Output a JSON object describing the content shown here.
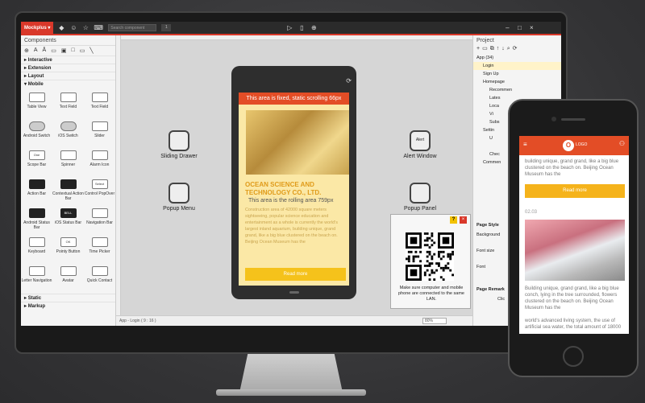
{
  "app": {
    "brand": "Mockplus",
    "search_placeholder": "Search component",
    "zoom_index": "1",
    "status_path": "App - Login ( 9 : 16 )",
    "zoom": "80%"
  },
  "components": {
    "title": "Components",
    "categories": {
      "interactive": "Interactive",
      "extension": "Extension",
      "layout": "Layout",
      "mobile": "Mobile",
      "static": "Static",
      "markup": "Markup"
    },
    "mobile_items": [
      {
        "label": "Table View",
        "icon": "table-view-icon"
      },
      {
        "label": "Text Field",
        "icon": "text-field-icon"
      },
      {
        "label": "Text Field",
        "icon": "text-field-icon"
      },
      {
        "label": "Android Switch",
        "icon": "android-switch-icon"
      },
      {
        "label": "iOS Switch",
        "icon": "ios-switch-icon"
      },
      {
        "label": "Slider",
        "icon": "slider-icon"
      },
      {
        "label": "Scope Bar",
        "icon": "scope-bar-icon",
        "thumb": "One"
      },
      {
        "label": "Spinner",
        "icon": "spinner-icon"
      },
      {
        "label": "Alarm Icon",
        "icon": "alarm-icon"
      },
      {
        "label": "Action Bar",
        "icon": "action-bar-icon"
      },
      {
        "label": "Contextual Action Bar",
        "icon": "contextual-action-bar-icon"
      },
      {
        "label": "Control PopOver",
        "icon": "control-popover-icon",
        "thumb": "Select"
      },
      {
        "label": "Android Status Bar",
        "icon": "android-status-bar-icon"
      },
      {
        "label": "iOS Status Bar",
        "icon": "ios-status-bar-icon",
        "thumb": "BELL"
      },
      {
        "label": "Navigation Bar",
        "icon": "navigation-bar-icon"
      },
      {
        "label": "Keyboard",
        "icon": "keyboard-icon"
      },
      {
        "label": "Pointy Button",
        "icon": "pointy-button-icon",
        "thumb": "OK"
      },
      {
        "label": "Time Picker",
        "icon": "time-picker-icon"
      },
      {
        "label": "Letter Navigation",
        "icon": "letter-navigation-icon"
      },
      {
        "label": "Avatar",
        "icon": "avatar-icon"
      },
      {
        "label": "Quick Contact",
        "icon": "quick-contact-icon"
      }
    ]
  },
  "canvas": {
    "left_blocks": [
      "Sliding Drawer",
      "Popup Menu"
    ],
    "right_blocks": [
      "Alert Window",
      "Popup Panel"
    ],
    "alert_thumb": "Alert",
    "device": {
      "header": "This area is fixed, static scrolling 66px",
      "title": "OCEAN SCIENCE AND TECHNOLOGY CO., LTD.",
      "subtitle": "This area is the rolling area 759px",
      "body": "Construction area of 42000 square meters sightseeing, popular science education and entertainment as a whole is currently the world's largest inland aquarium, building unique, grand grand, like a big blue clustered on the beach on. Beijing Ocean Museum has the",
      "button": "Read more"
    },
    "qr_text": "Make sure computer and mobile phone are connected to the same LAN."
  },
  "project": {
    "title": "Project",
    "tree": [
      {
        "label": "App (34)",
        "level": 0
      },
      {
        "label": "Login",
        "level": 1,
        "selected": true
      },
      {
        "label": "Sign Up",
        "level": 1
      },
      {
        "label": "Homepage",
        "level": 1
      },
      {
        "label": "Recommen",
        "level": 2
      },
      {
        "label": "Lates",
        "level": 2
      },
      {
        "label": "Loca",
        "level": 2
      },
      {
        "label": "Vi",
        "level": 2
      },
      {
        "label": "Subs",
        "level": 2
      },
      {
        "label": "Settin",
        "level": 1
      },
      {
        "label": "U",
        "level": 2
      },
      {
        "label": "",
        "level": 2
      },
      {
        "label": "Chec",
        "level": 2
      },
      {
        "label": "Commen",
        "level": 1
      }
    ],
    "page_style": "Page Style",
    "background": "Background",
    "font_size": "Font size",
    "font": "Font",
    "page_remark": "Page Remark",
    "click": "Clic"
  },
  "phone": {
    "logo": "O",
    "logo_text": "LOGO",
    "top_text": "building unique, grand grand, like a big blue clustered on the beach on. Beijing Ocean Museum has the",
    "button": "Read more",
    "date": "02.03",
    "bottom_text": "Building unique, grand grand, like a big blue conch, lying in the tree surrounded, flowers clustered on the beach on. Beijing Ocean Museum has the",
    "bottom_text2": "world's advanced living system, the use of artificial sea water, the total amount of 18000"
  }
}
